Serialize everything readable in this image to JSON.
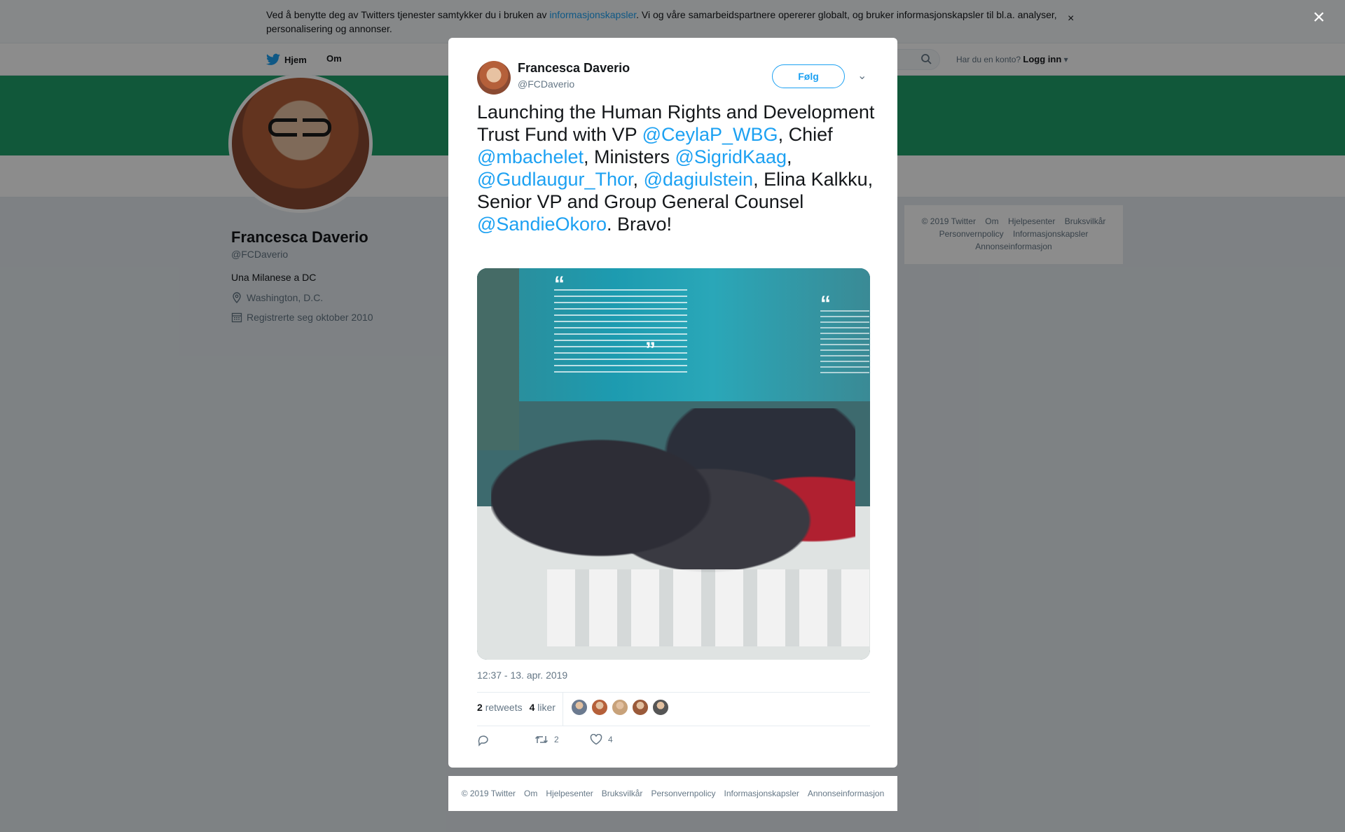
{
  "cookie": {
    "text_before": "Ved å benytte deg av Twitters tjenester samtykker du i bruken av ",
    "link": "informasjonskapsler",
    "text_after": ". Vi og våre samarbeidspartnere opererer globalt, og bruker informasjonskapsler til bl.a. analyser, personalisering og annonser.",
    "close": "×"
  },
  "nav": {
    "home": "Hjem",
    "about": "Om",
    "login_question": "Har du en konto?",
    "login_link": "Logg inn"
  },
  "profile": {
    "name": "Francesca Daverio",
    "handle": "@FCDaverio",
    "bio": "Una Milanese a DC",
    "location": "Washington, D.C.",
    "joined": "Registrerte seg oktober 2010"
  },
  "side_footer": [
    "© 2019 Twitter",
    "Om",
    "Hjelpesenter",
    "Bruksvilkår",
    "Personvernpolicy",
    "Informasjonskapsler",
    "Annonseinformasjon"
  ],
  "overlay": {
    "close": "×"
  },
  "tweet": {
    "author_name": "Francesca Daverio",
    "author_handle": "@FCDaverio",
    "follow_label": "Følg",
    "text_parts": [
      {
        "text": "Launching the Human Rights and Development Trust Fund with VP ",
        "mention": false
      },
      {
        "text": "@CeylaP_WBG",
        "mention": true
      },
      {
        "text": ", Chief ",
        "mention": false
      },
      {
        "text": "@mbachelet",
        "mention": true
      },
      {
        "text": ", Ministers ",
        "mention": false
      },
      {
        "text": "@SigridKaag",
        "mention": true
      },
      {
        "text": ", ",
        "mention": false
      },
      {
        "text": "@Gudlaugur_Thor",
        "mention": true
      },
      {
        "text": ", ",
        "mention": false
      },
      {
        "text": "@dagiulstein",
        "mention": true
      },
      {
        "text": ", Elina Kalkku, Senior VP and Group General Counsel ",
        "mention": false
      },
      {
        "text": "@SandieOkoro",
        "mention": true
      },
      {
        "text": ". Bravo!",
        "mention": false
      }
    ],
    "timestamp": "12:37 - 13. apr. 2019",
    "retweets_count": "2",
    "retweets_label": "retweets",
    "likes_count": "4",
    "likes_label": "liker",
    "action_retweets": "2",
    "action_likes": "4",
    "liker_colors": [
      "#6b7a8f",
      "#b5603a",
      "#c8a27a",
      "#9a5a3a",
      "#555555"
    ]
  },
  "modal_footer": [
    "© 2019 Twitter",
    "Om",
    "Hjelpesenter",
    "Bruksvilkår",
    "Personvernpolicy",
    "Informasjonskapsler",
    "Annonseinformasjon"
  ],
  "colors": {
    "accent": "#1da1f2",
    "banner": "#1fa16a"
  }
}
